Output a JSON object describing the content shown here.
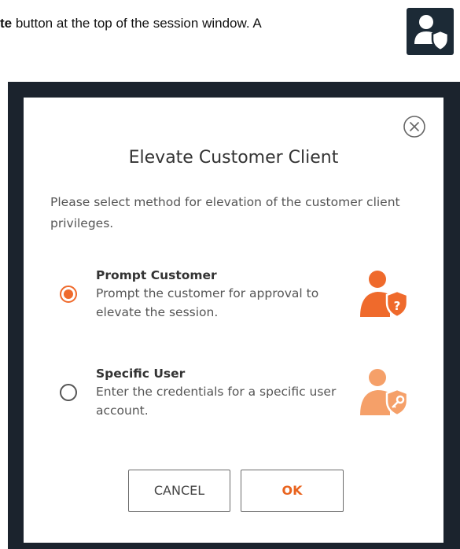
{
  "doc": {
    "bold_fragment": "te",
    "text_after": " button at the top of the session window. A"
  },
  "icons": {
    "elevate_tile": "user-shield-icon",
    "close": "close-circle-icon",
    "prompt_customer": "user-shield-question-icon",
    "specific_user": "user-shield-key-icon"
  },
  "colors": {
    "accent": "#ef6a2c",
    "accent_light": "#f5a069",
    "dark_frame": "#1b232d",
    "tile_bg": "#1c2a36"
  },
  "dialog": {
    "title": "Elevate Customer Client",
    "description": "Please select method for elevation of the customer client privileges.",
    "options": [
      {
        "title": "Prompt Customer",
        "description": "Prompt the customer for approval to elevate the session.",
        "selected": true
      },
      {
        "title": "Specific User",
        "description": "Enter the credentials for a specific user account.",
        "selected": false
      }
    ],
    "cancel_label": "CANCEL",
    "ok_label": "OK"
  }
}
